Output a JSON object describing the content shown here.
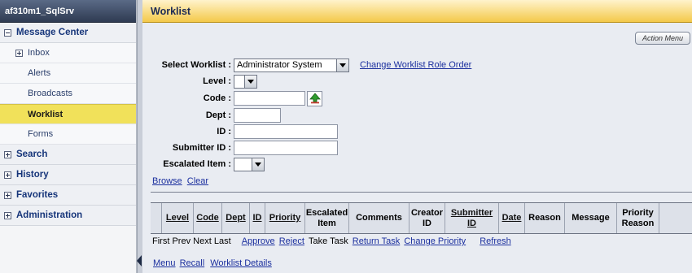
{
  "sidebar": {
    "server": "af310m1_SqlSrv",
    "message_center": "Message Center",
    "inbox": "Inbox",
    "alerts": "Alerts",
    "broadcasts": "Broadcasts",
    "worklist": "Worklist",
    "forms": "Forms",
    "search": "Search",
    "history": "History",
    "favorites": "Favorites",
    "administration": "Administration"
  },
  "main": {
    "title": "Worklist",
    "action_menu": "Action Menu",
    "form": {
      "select_worklist_label": "Select Worklist :",
      "select_worklist_value": "Administrator System",
      "change_role_order": "Change Worklist Role Order",
      "level_label": "Level :",
      "code_label": "Code :",
      "dept_label": "Dept :",
      "id_label": "ID :",
      "submitter_id_label": "Submitter ID :",
      "escalated_item_label": "Escalated Item :"
    },
    "browse": "Browse",
    "clear": "Clear",
    "columns": [
      "Level",
      "Code",
      "Dept",
      "ID",
      "Priority",
      "Escalated Item",
      "Comments",
      "Creator ID",
      "Submitter ID",
      "Date",
      "Reason",
      "Message",
      "Priority Reason"
    ],
    "pager": {
      "first": "First",
      "prev": "Prev",
      "next": "Next",
      "last": "Last"
    },
    "actions": {
      "approve": "Approve",
      "reject": "Reject",
      "take_task": "Take Task",
      "return_task": "Return Task",
      "change_priority": "Change Priority",
      "refresh": "Refresh"
    },
    "footer": {
      "menu": "Menu",
      "recall": "Recall",
      "worklist_details": "Worklist Details"
    }
  }
}
